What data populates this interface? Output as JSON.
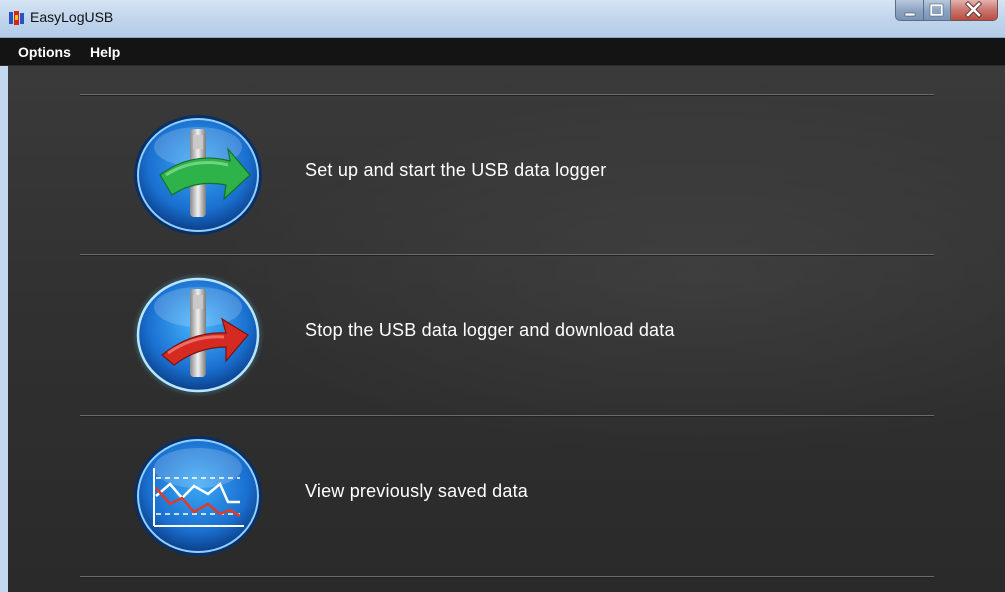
{
  "window": {
    "title": "EasyLogUSB"
  },
  "menu": {
    "items": [
      "Options",
      "Help"
    ]
  },
  "actions": [
    {
      "label": "Set up and start the USB data logger",
      "icon": "usb-logger-green-arrow-icon",
      "arrow_color": "#2eb24a"
    },
    {
      "label": "Stop the USB data logger and download data",
      "icon": "usb-logger-red-arrow-icon",
      "arrow_color": "#d42a22"
    },
    {
      "label": "View previously saved data",
      "icon": "line-graph-icon"
    }
  ],
  "colors": {
    "button_blue": "#1c78d4",
    "content_bg": "#333333",
    "menubar_bg": "#141414",
    "titlebar_bg": "#c3d7ee"
  }
}
